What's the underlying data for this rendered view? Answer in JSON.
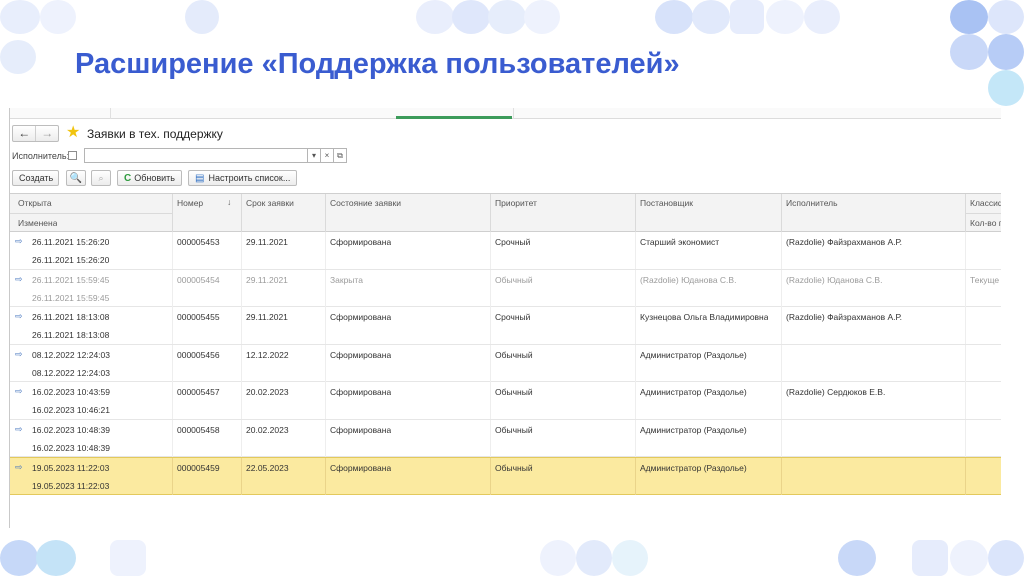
{
  "slide": {
    "title": "Расширение «Поддержка пользователей»"
  },
  "form": {
    "title": "Заявки в тех. поддержку",
    "nav": {
      "back_icon": "←",
      "forward_icon": "→",
      "favorite_icon": "★"
    },
    "filter": {
      "label": "Исполнитель:",
      "value": "",
      "dropdown_icon": "▾",
      "clear_icon": "×",
      "open_icon": "⧉"
    },
    "commands": {
      "create_label": "Создать",
      "find_icon": "🔍",
      "cancel_find_icon": "⌕",
      "refresh_label": "Обновить",
      "refresh_icon": "C",
      "configure_label": "Настроить список...",
      "configure_icon": "▤"
    }
  },
  "table": {
    "headers": {
      "opened": "Открыта",
      "changed": "Изменена",
      "number": "Номер",
      "sort_icon": "↓",
      "due": "Срок заявки",
      "state": "Состояние заявки",
      "priority": "Приоритет",
      "author": "Постановщик",
      "executor": "Исполнитель",
      "classification": "Классиф",
      "count": "Кол-во п"
    },
    "rows": [
      {
        "opened": "26.11.2021 15:26:20",
        "changed": "26.11.2021 15:26:20",
        "number": "000005453",
        "due": "29.11.2021",
        "state": "Сформирована",
        "priority": "Срочный",
        "author": "Старший экономист",
        "executor": "(Razdolie) Файзрахманов А.Р.",
        "classification": ""
      },
      {
        "opened": "26.11.2021 15:59:45",
        "changed": "26.11.2021 15:59:45",
        "number": "000005454",
        "due": "29.11.2021",
        "state": "Закрыта",
        "priority": "Обычный",
        "author": "(Razdolie) Юданова С.В.",
        "executor": "(Razdolie) Юданова С.В.",
        "classification": "Текуще"
      },
      {
        "opened": "26.11.2021 18:13:08",
        "changed": "26.11.2021 18:13:08",
        "number": "000005455",
        "due": "29.11.2021",
        "state": "Сформирована",
        "priority": "Срочный",
        "author": "Кузнецова Ольга Владимировна",
        "executor": "(Razdolie) Файзрахманов А.Р.",
        "classification": ""
      },
      {
        "opened": "08.12.2022 12:24:03",
        "changed": "08.12.2022 12:24:03",
        "number": "000005456",
        "due": "12.12.2022",
        "state": "Сформирована",
        "priority": "Обычный",
        "author": "Администратор (Раздолье)",
        "executor": "",
        "classification": ""
      },
      {
        "opened": "16.02.2023 10:43:59",
        "changed": "16.02.2023 10:46:21",
        "number": "000005457",
        "due": "20.02.2023",
        "state": "Сформирована",
        "priority": "Обычный",
        "author": "Администратор (Раздолье)",
        "executor": "(Razdolie) Сердюков Е.В.",
        "classification": ""
      },
      {
        "opened": "16.02.2023 10:48:39",
        "changed": "16.02.2023 10:48:39",
        "number": "000005458",
        "due": "20.02.2023",
        "state": "Сформирована",
        "priority": "Обычный",
        "author": "Администратор (Раздолье)",
        "executor": "",
        "classification": ""
      },
      {
        "opened": "19.05.2023 11:22:03",
        "changed": "19.05.2023 11:22:03",
        "number": "000005459",
        "due": "22.05.2023",
        "state": "Сформирована",
        "priority": "Обычный",
        "author": "Администратор (Раздолье)",
        "executor": "",
        "classification": ""
      }
    ],
    "row_icon": "⇨",
    "closed_row_index": 1,
    "selected_row_index": 6
  },
  "colors": {
    "title": "#3a5cd0",
    "selection": "#fbeaa0",
    "decor_light": "#dde6fb",
    "decor_mid": "#b9cdf5",
    "decor_cyan": "#bfe6f7"
  }
}
